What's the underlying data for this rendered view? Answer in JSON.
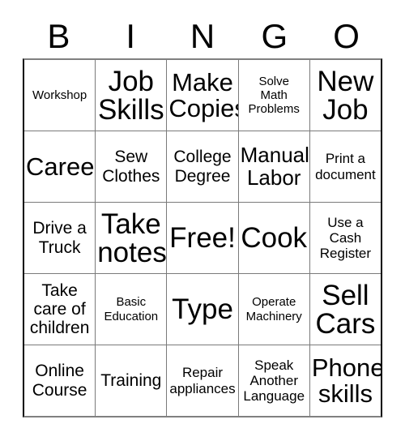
{
  "card": {
    "title": "BINGO",
    "free_space_label": "Free!",
    "grid_line_color": "#7a7a7a",
    "text_color": "#000000",
    "background_color": "#ffffff"
  },
  "header": {
    "letters": [
      "B",
      "I",
      "N",
      "G",
      "O"
    ]
  },
  "grid": {
    "columns": 5,
    "rows": 5,
    "cells": [
      [
        {
          "text": "Workshop",
          "size": "xs"
        },
        {
          "text": "Job\nSkills",
          "size": "xxl"
        },
        {
          "text": "Make\nCopies",
          "size": "xl"
        },
        {
          "text": "Solve\nMath\nProblems",
          "size": "xs"
        },
        {
          "text": "New\nJob",
          "size": "xxl"
        }
      ],
      [
        {
          "text": "Career",
          "size": "xl"
        },
        {
          "text": "Sew\nClothes",
          "size": "md"
        },
        {
          "text": "College\nDegree",
          "size": "md"
        },
        {
          "text": "Manual\nLabor",
          "size": "lg"
        },
        {
          "text": "Print a\ndocument",
          "size": "sm"
        }
      ],
      [
        {
          "text": "Drive a\nTruck",
          "size": "md"
        },
        {
          "text": "Take\nnotes",
          "size": "xxl"
        },
        {
          "text": "Free!",
          "size": "xxl"
        },
        {
          "text": "Cook",
          "size": "xxl"
        },
        {
          "text": "Use a\nCash\nRegister",
          "size": "sm"
        }
      ],
      [
        {
          "text": "Take\ncare of\nchildren",
          "size": "md"
        },
        {
          "text": "Basic\nEducation",
          "size": "xs"
        },
        {
          "text": "Type",
          "size": "xxl"
        },
        {
          "text": "Operate\nMachinery",
          "size": "xs"
        },
        {
          "text": "Sell\nCars",
          "size": "xxl"
        }
      ],
      [
        {
          "text": "Online\nCourse",
          "size": "md"
        },
        {
          "text": "Training",
          "size": "md"
        },
        {
          "text": "Repair\nappliances",
          "size": "sm"
        },
        {
          "text": "Speak\nAnother\nLanguage",
          "size": "sm"
        },
        {
          "text": "Phone\nskills",
          "size": "xl"
        }
      ]
    ]
  }
}
